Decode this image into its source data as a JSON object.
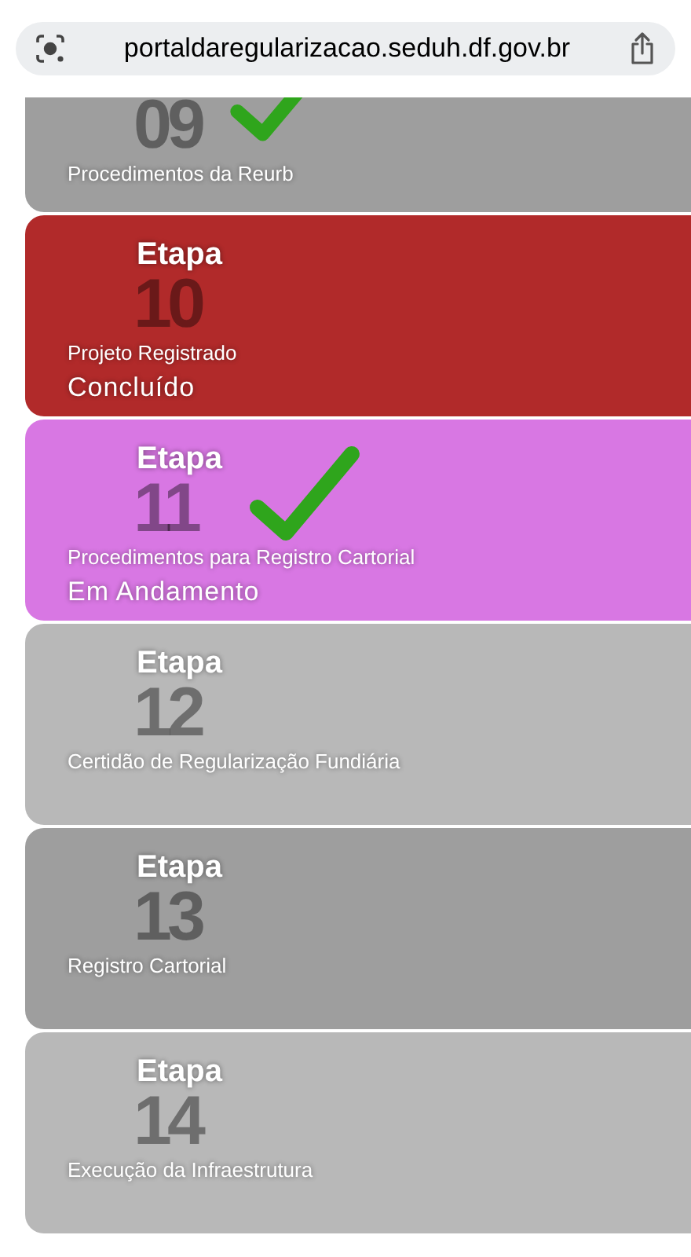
{
  "address_bar": {
    "url": "portaldaregularizacao.seduh.df.gov.br"
  },
  "steps": [
    {
      "number": "09",
      "title": "Procedimentos da Reurb",
      "color": "#9e9e9e",
      "checked": true,
      "partial": true
    },
    {
      "label": "Etapa",
      "number": "10",
      "title": "Projeto Registrado",
      "status": "Concluído",
      "color": "#b12a2a",
      "checked": false
    },
    {
      "label": "Etapa",
      "number": "11",
      "title": "Procedimentos para Registro Cartorial",
      "status": "Em Andamento",
      "color": "#d877e3",
      "checked": true
    },
    {
      "label": "Etapa",
      "number": "12",
      "title": "Certidão de Regularização Fundiária",
      "color": "#b8b8b8",
      "checked": false
    },
    {
      "label": "Etapa",
      "number": "13",
      "title": "Registro Cartorial",
      "color": "#9e9e9e",
      "checked": false
    },
    {
      "label": "Etapa",
      "number": "14",
      "title": "Execução da Infraestrutura",
      "color": "#b8b8b8",
      "checked": false
    }
  ]
}
